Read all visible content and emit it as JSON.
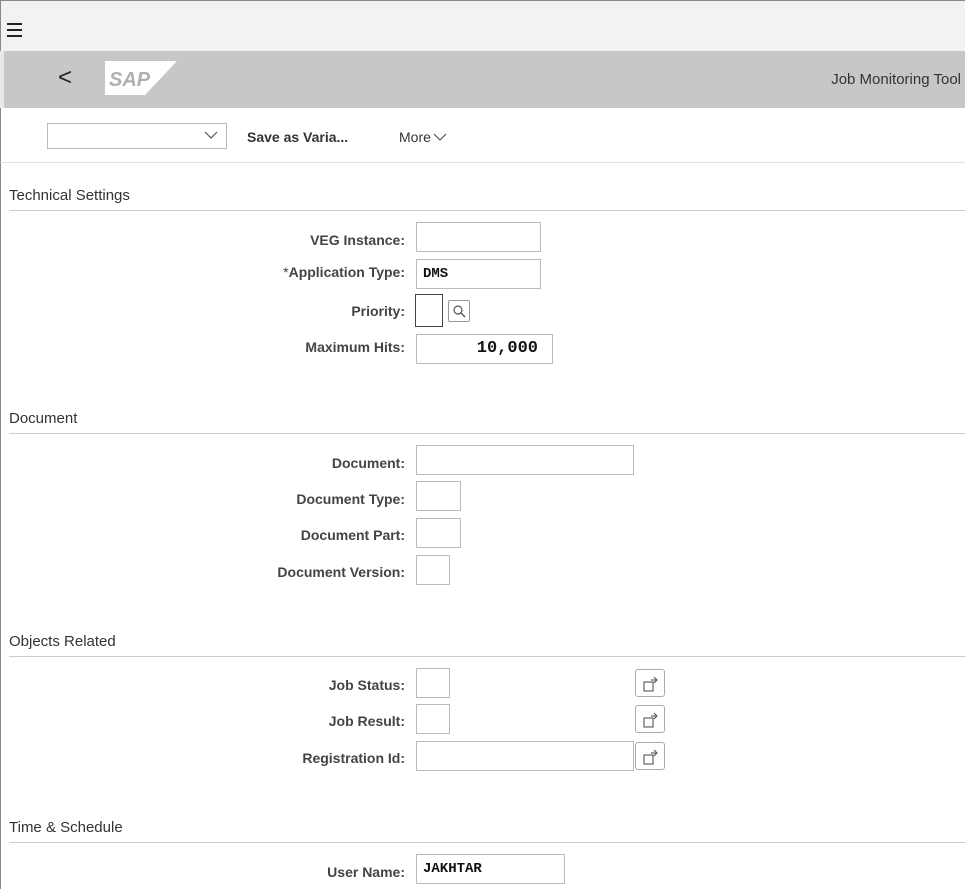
{
  "shell": {
    "menu_icon": "hamburger-icon",
    "back_icon": "back-chevron-icon",
    "back_glyph": "<",
    "logo": "SAP",
    "app_title": "Job Monitoring Tool"
  },
  "toolbar": {
    "variant_value": "",
    "save_as_variant": "Save as Varia...",
    "more": "More"
  },
  "sections": {
    "technical": {
      "title": "Technical Settings",
      "veg_instance": {
        "label": "VEG Instance:",
        "value": ""
      },
      "application_type": {
        "required_mark": "*",
        "label": "Application Type:",
        "value": "DMS"
      },
      "priority": {
        "label": "Priority:",
        "value": ""
      },
      "maximum_hits": {
        "label": "Maximum Hits:",
        "value": "10,000"
      }
    },
    "document": {
      "title": "Document",
      "document": {
        "label": "Document:",
        "value": ""
      },
      "document_type": {
        "label": "Document Type:",
        "value": ""
      },
      "document_part": {
        "label": "Document Part:",
        "value": ""
      },
      "document_version": {
        "label": "Document Version:",
        "value": ""
      }
    },
    "objects": {
      "title": "Objects Related",
      "job_status": {
        "label": "Job Status:",
        "value": ""
      },
      "job_result": {
        "label": "Job Result:",
        "value": ""
      },
      "registration_id": {
        "label": "Registration Id:",
        "value": ""
      }
    },
    "time": {
      "title": "Time & Schedule",
      "user_name": {
        "label": "User Name:",
        "value": "JAKHTAR"
      }
    }
  }
}
